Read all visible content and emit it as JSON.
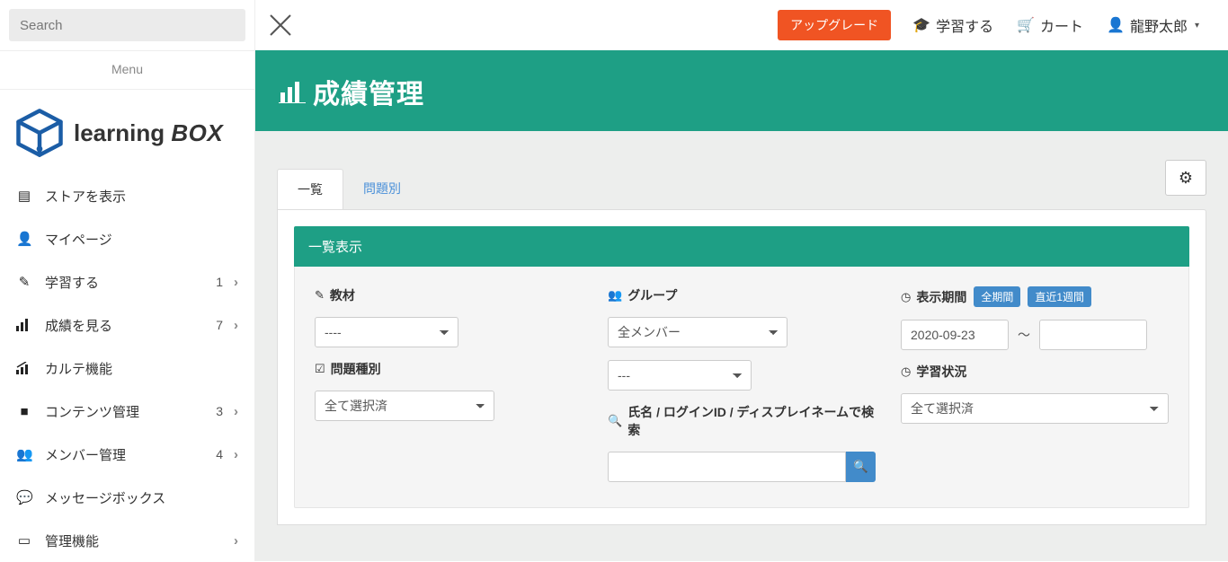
{
  "sidebar": {
    "search_placeholder": "Search",
    "menu_label": "Menu",
    "logo_text1": "learning",
    "logo_text2": "BOX",
    "items": [
      {
        "icon": "book",
        "label": "ストアを表示",
        "badge": "",
        "chevron": false
      },
      {
        "icon": "user",
        "label": "マイページ",
        "badge": "",
        "chevron": false
      },
      {
        "icon": "pencil",
        "label": "学習する",
        "badge": "1",
        "chevron": true
      },
      {
        "icon": "bar",
        "label": "成績を見る",
        "badge": "7",
        "chevron": true
      },
      {
        "icon": "stats",
        "label": "カルテ機能",
        "badge": "",
        "chevron": false
      },
      {
        "icon": "folder",
        "label": "コンテンツ管理",
        "badge": "3",
        "chevron": true
      },
      {
        "icon": "users",
        "label": "メンバー管理",
        "badge": "4",
        "chevron": true
      },
      {
        "icon": "chat",
        "label": "メッセージボックス",
        "badge": "",
        "chevron": false
      },
      {
        "icon": "laptop",
        "label": "管理機能",
        "badge": "",
        "chevron": true
      }
    ]
  },
  "header": {
    "upgrade": "アップグレード",
    "learn": "学習する",
    "cart": "カート",
    "user": "龍野太郎"
  },
  "page": {
    "title": "成績管理",
    "tabs": {
      "list": "一覧",
      "by_question": "問題別"
    },
    "section_title": "一覧表示",
    "fields": {
      "material_label": "教材",
      "material_value": "----",
      "type_label": "問題種別",
      "type_value": "全て選択済",
      "group_label": "グループ",
      "group_value": "全メンバー",
      "group_sub_value": "---",
      "name_label": "氏名 / ログインID / ディスプレイネームで検索",
      "period_label": "表示期間",
      "period_pill_all": "全期間",
      "period_pill_week": "直近1週間",
      "period_from": "2020-09-23",
      "period_to": "",
      "tilde": "〜",
      "status_label": "学習状況",
      "status_value": "全て選択済"
    }
  }
}
